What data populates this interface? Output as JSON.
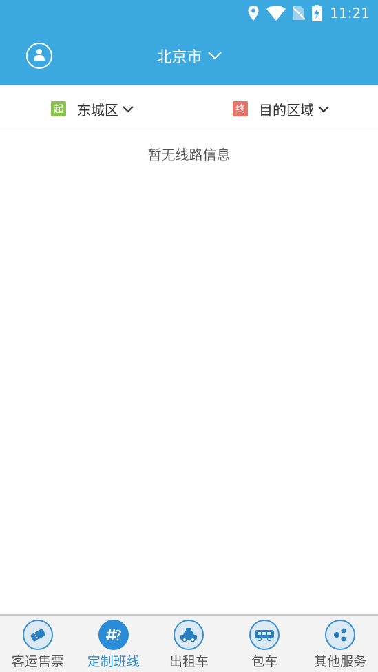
{
  "status_bar": {
    "time": "11:21",
    "icons": [
      "location-icon",
      "wifi-icon",
      "no-sim-icon",
      "battery-charging-icon"
    ]
  },
  "header": {
    "city": "北京市",
    "avatar_icon": "user-icon",
    "dropdown_icon": "chevron-down-icon"
  },
  "route": {
    "from_tag": "起",
    "from_value": "东城区",
    "to_tag": "终",
    "to_value": "目的区域",
    "from_tag_color": "#8cc152",
    "to_tag_color": "#e57368"
  },
  "empty_message": "暂无线路信息",
  "nav": {
    "items": [
      {
        "label": "客运售票",
        "icon": "ticket-icon",
        "active": false
      },
      {
        "label": "定制班线",
        "icon": "custom-route-icon",
        "active": true
      },
      {
        "label": "出租车",
        "icon": "taxi-icon",
        "active": false
      },
      {
        "label": "包车",
        "icon": "bus-icon",
        "active": false
      },
      {
        "label": "其他服务",
        "icon": "share-dots-icon",
        "active": false
      }
    ]
  },
  "colors": {
    "header_blue": "#3ca8e0",
    "active_blue": "#2a8cd6"
  }
}
